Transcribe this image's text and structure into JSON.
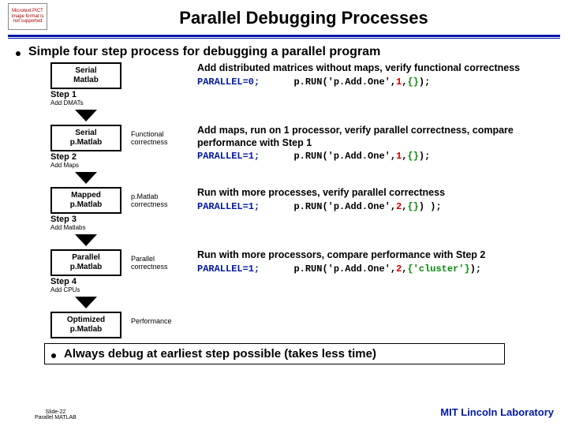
{
  "header": {
    "pict_text": "Microtext PICT image format is not supported",
    "title": "Parallel Debugging Processes"
  },
  "bullet1": "Simple four step process for debugging a parallel program",
  "steps": [
    {
      "box": "Serial\nMatlab",
      "step_label": "Step 1",
      "sub_label": "Add DMATs",
      "mid": "",
      "desc": "Add distributed matrices without maps, verify functional correctness",
      "code_parallel": "PARALLEL=0;",
      "code_run_pre": "p.RUN('p.Add.One',",
      "code_run_red": "1",
      "code_run_mid": ",",
      "code_run_green": "{}",
      "code_run_post": ");"
    },
    {
      "box": "Serial\np.Matlab",
      "step_label": "Step 2",
      "sub_label": "Add Maps",
      "mid": "Functional correctness",
      "desc": "Add maps, run on 1 processor, verify parallel correctness, compare performance with Step 1",
      "code_parallel": "PARALLEL=1;",
      "code_run_pre": "p.RUN('p.Add.One',",
      "code_run_red": "1",
      "code_run_mid": ",",
      "code_run_green": "{}",
      "code_run_post": ");"
    },
    {
      "box": "Mapped\np.Matlab",
      "step_label": "Step 3",
      "sub_label": "Add Matlabs",
      "mid": "p.Matlab correctness",
      "desc": "Run with more processes, verify parallel correctness",
      "code_parallel": "PARALLEL=1;",
      "code_run_pre": "p.RUN('p.Add.One',",
      "code_run_red": "2",
      "code_run_mid": ",",
      "code_run_green": "{}",
      "code_run_post": ") );"
    },
    {
      "box": "Parallel\np.Matlab",
      "step_label": "Step 4",
      "sub_label": "Add CPUs",
      "mid": "Parallel correctness",
      "desc": "Run with more processors, compare performance with Step 2",
      "code_parallel": "PARALLEL=1;",
      "code_run_pre": "p.RUN('p.Add.One',",
      "code_run_red": "2",
      "code_run_mid": ",",
      "code_run_green": "{'cluster'}",
      "code_run_post": ");"
    },
    {
      "box": "Optimized\np.Matlab",
      "step_label": "",
      "sub_label": "",
      "mid": "Performance",
      "desc": "",
      "code_parallel": "",
      "code_run_pre": "",
      "code_run_red": "",
      "code_run_mid": "",
      "code_run_green": "",
      "code_run_post": ""
    }
  ],
  "closing": "Always debug at earliest step possible (takes less time)",
  "footer": {
    "left_line1": "Slide-22",
    "left_line2": "Parallel MATLAB",
    "right": "MIT Lincoln Laboratory"
  }
}
